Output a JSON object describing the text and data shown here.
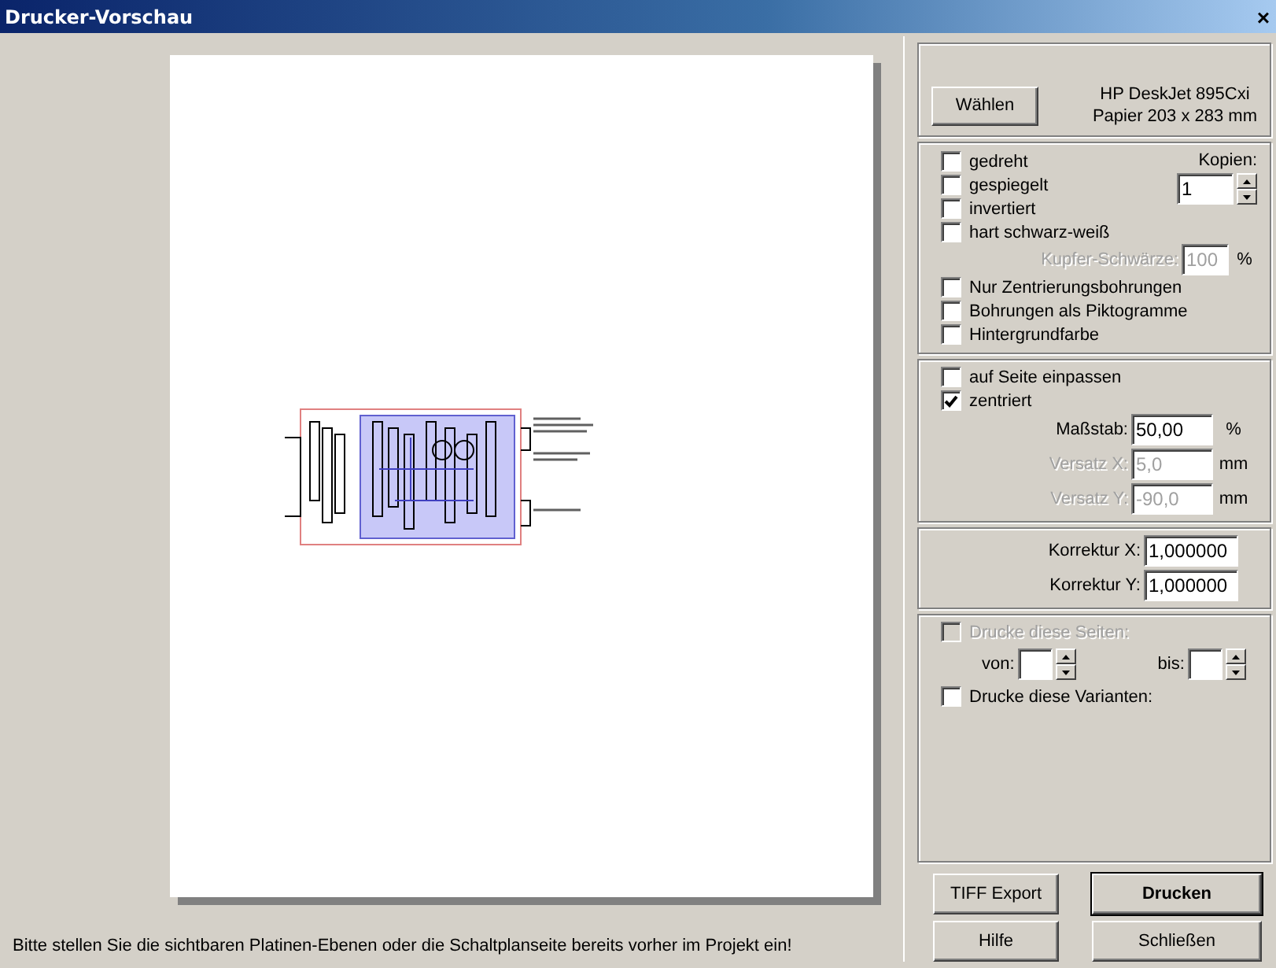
{
  "window": {
    "title": "Drucker-Vorschau",
    "close": "×"
  },
  "status": "Bitte stellen Sie die sichtbaren Platinen-Ebenen oder die Schaltplanseite bereits vorher im Projekt ein!",
  "printer": {
    "button": "Wählen",
    "name": "HP DeskJet 895Cxi",
    "paper": "Papier 203 x 283 mm"
  },
  "copies": {
    "label": "Kopien:",
    "value": "1"
  },
  "options": [
    {
      "label": "gedreht",
      "checked": false
    },
    {
      "label": "gespiegelt",
      "checked": false
    },
    {
      "label": "invertiert",
      "checked": false
    },
    {
      "label": "hart schwarz-weiß",
      "checked": false
    }
  ],
  "copper": {
    "label": "Kupfer-Schwärze:",
    "value": "100",
    "unit": "%",
    "disabled": true
  },
  "options2": [
    {
      "label": "Nur Zentrierungsbohrungen",
      "checked": false
    },
    {
      "label": "Bohrungen als Piktogramme",
      "checked": false
    },
    {
      "label": "Hintergrundfarbe",
      "checked": false
    }
  ],
  "placement": [
    {
      "label": "auf Seite einpassen",
      "checked": false
    },
    {
      "label": "zentriert",
      "checked": true
    }
  ],
  "scale_fields": [
    {
      "label": "Maßstab:",
      "value": "50,00",
      "unit": "%",
      "disabled": false
    },
    {
      "label": "Versatz X:",
      "value": "5,0",
      "unit": "mm",
      "disabled": true
    },
    {
      "label": "Versatz Y:",
      "value": "-90,0",
      "unit": "mm",
      "disabled": true
    }
  ],
  "correction": [
    {
      "label": "Korrektur X:",
      "value": "1,000000"
    },
    {
      "label": "Korrektur Y:",
      "value": "1,000000"
    }
  ],
  "pages": {
    "label": "Drucke diese Seiten:",
    "checked": false,
    "disabled": true,
    "from": "von:",
    "to": "bis:"
  },
  "variants": {
    "label": "Drucke diese Varianten:",
    "checked": false
  },
  "buttons": [
    {
      "label": "TIFF Export",
      "default": false
    },
    {
      "label": "Drucken",
      "default": true
    },
    {
      "label": "Hilfe",
      "default": false
    },
    {
      "label": "Schließen",
      "default": false
    }
  ]
}
